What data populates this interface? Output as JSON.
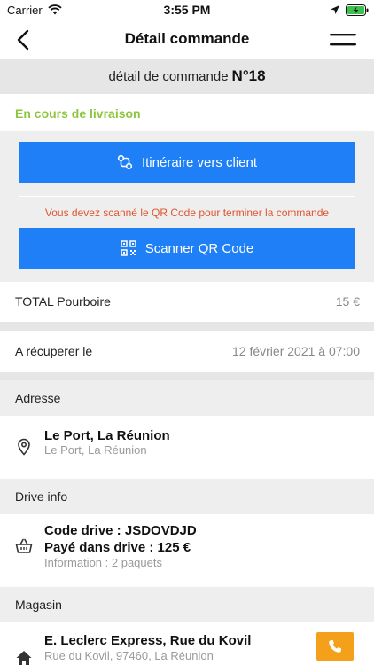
{
  "status_bar": {
    "carrier": "Carrier",
    "time": "3:55 PM",
    "icons": [
      "wifi-icon",
      "location-arrow-icon",
      "battery-charging-icon"
    ]
  },
  "nav": {
    "title": "Détail commande",
    "back_icon": "chevron-left-icon",
    "menu_icon": "menu-icon"
  },
  "order": {
    "label": "détail de commande",
    "number": "N°18",
    "status": "En cours de livraison"
  },
  "actions": {
    "route_label": "Itinéraire vers client",
    "route_icon": "route-icon",
    "warning": "Vous devez scanné le QR Code pour terminer la commande",
    "scan_label": "Scanner QR Code",
    "scan_icon": "qr-code-icon"
  },
  "tip": {
    "label": "TOTAL Pourboire",
    "value": "15 €"
  },
  "pickup": {
    "label": "A récuperer le",
    "value": "12 février 2021 à 07:00"
  },
  "address": {
    "section": "Adresse",
    "title": "Le Port, La Réunion",
    "detail": "Le Port, La Réunion",
    "icon": "location-pin-icon"
  },
  "drive": {
    "section": "Drive info",
    "code": "Code drive : JSDOVDJD",
    "paid": "Payé dans drive : 125 €",
    "info": "Information : 2 paquets",
    "icon": "basket-icon"
  },
  "store": {
    "section": "Magasin",
    "name": "E. Leclerc Express, Rue du Kovil",
    "address": "Rue du Kovil, 97460, La Réunion",
    "icon": "home-icon",
    "call_icon": "phone-icon"
  },
  "colors": {
    "accent_blue": "#1f7ff6",
    "status_green": "#8cc63f",
    "warning_red": "#e0542d",
    "call_orange": "#f4a01b",
    "section_gray": "#eeeeee"
  }
}
